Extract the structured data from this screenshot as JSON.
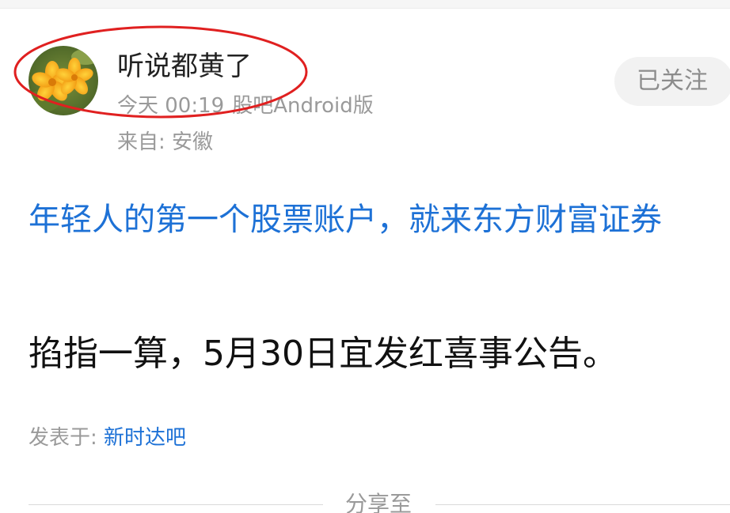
{
  "author": {
    "name": "听说都黄了",
    "avatar_icon": "yellow-flower-avatar",
    "post_time": "今天 00:19",
    "client": "股吧Android版",
    "location": "来自: 安徽"
  },
  "follow_button": {
    "label": "已关注"
  },
  "promo": {
    "text": "年轻人的第一个股票账户，就来东方财富证券",
    "color": "#1d71d6"
  },
  "post": {
    "body": "掐指一算，5月30日宜发红喜事公告。"
  },
  "posted_in": {
    "prefix": "发表于: ",
    "forum": "新时达吧"
  },
  "share": {
    "label": "分享至"
  },
  "colors": {
    "link_blue": "#1d71d6",
    "annotation_red": "#e02020",
    "muted_text": "#9a9a9a"
  }
}
